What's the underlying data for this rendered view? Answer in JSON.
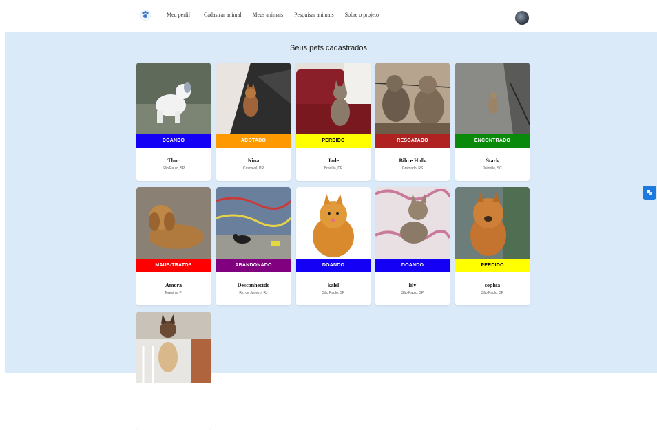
{
  "nav": {
    "items": [
      "Meu perfil",
      "Cadastrar animal",
      "Meus animais",
      "Pesquisar animais",
      "Sobre o projeto"
    ]
  },
  "page": {
    "title": "Seus pets cadastrados"
  },
  "status_colors": {
    "DOANDO": "#1400f5",
    "ADOTADO": "#ff9900",
    "PERDIDO": "#ffff00",
    "RESGATADO": "#b02222",
    "ENCONTRADO": "#0a8a0a",
    "MAUS-TRATOS": "#ff0000",
    "ABANDONADO": "#800080"
  },
  "pets": [
    {
      "name": "Thor",
      "location": "São Paulo, SP",
      "status": "DOANDO",
      "photo": "dog-white-puppy"
    },
    {
      "name": "Nina",
      "location": "Cascavel, PR",
      "status": "ADOTADO",
      "photo": "dog-small-brown"
    },
    {
      "name": "Jade",
      "location": "Brasília, DF",
      "status": "PERDIDO",
      "photo": "cat-tabby-sofa"
    },
    {
      "name": "Bilu e Hulk",
      "location": "Gramado, RS",
      "status": "RESGATADO",
      "photo": "dogs-pitbull-pair"
    },
    {
      "name": "Stark",
      "location": "Joinville, SC",
      "status": "ENCONTRADO",
      "photo": "cat-tabby-street"
    },
    {
      "name": "Amora",
      "location": "Teresina, PI",
      "status": "MAUS-TRATOS",
      "photo": "dog-golden-lying"
    },
    {
      "name": "Desconhecido",
      "location": "Rio de Janeiro, RJ",
      "status": "ABANDONADO",
      "photo": "dog-black-street"
    },
    {
      "name": "kalel",
      "location": "São Paulo, SP",
      "status": "DOANDO",
      "photo": "dog-pomeranian"
    },
    {
      "name": "lily",
      "location": "São Paulo, SP",
      "status": "DOANDO",
      "photo": "cat-kitten-tabby"
    },
    {
      "name": "sophia",
      "location": "São Paulo, SP",
      "status": "PERDIDO",
      "photo": "dog-chow-chow"
    },
    {
      "name": "",
      "location": "",
      "status": "",
      "photo": "cat-siamese"
    }
  ]
}
